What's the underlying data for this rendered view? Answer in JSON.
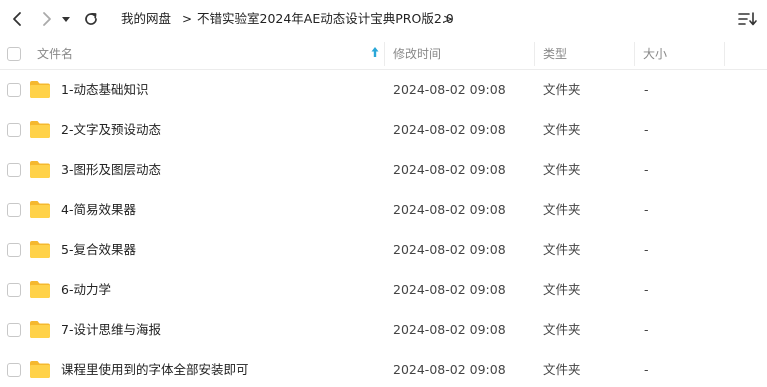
{
  "toolbar": {
    "breadcrumb_root": "我的网盘",
    "breadcrumb_current": "不错实验室2024年AE动态设计宝典PRO版2.0",
    "separator": ">"
  },
  "columns": {
    "name": "文件名",
    "modified": "修改时间",
    "type": "类型",
    "size": "大小"
  },
  "rows": [
    {
      "name": "1-动态基础知识",
      "modified": "2024-08-02 09:08",
      "type": "文件夹",
      "size": "-"
    },
    {
      "name": "2-文字及预设动态",
      "modified": "2024-08-02 09:08",
      "type": "文件夹",
      "size": "-"
    },
    {
      "name": "3-图形及图层动态",
      "modified": "2024-08-02 09:08",
      "type": "文件夹",
      "size": "-"
    },
    {
      "name": "4-简易效果器",
      "modified": "2024-08-02 09:08",
      "type": "文件夹",
      "size": "-"
    },
    {
      "name": "5-复合效果器",
      "modified": "2024-08-02 09:08",
      "type": "文件夹",
      "size": "-"
    },
    {
      "name": "6-动力学",
      "modified": "2024-08-02 09:08",
      "type": "文件夹",
      "size": "-"
    },
    {
      "name": "7-设计思维与海报",
      "modified": "2024-08-02 09:08",
      "type": "文件夹",
      "size": "-"
    },
    {
      "name": "课程里使用到的字体全部安装即可",
      "modified": "2024-08-02 09:08",
      "type": "文件夹",
      "size": "-"
    }
  ],
  "colors": {
    "folder": "#ffd24a",
    "folder_tab": "#f5b82e",
    "sort_arrow": "#2aa7d8"
  }
}
